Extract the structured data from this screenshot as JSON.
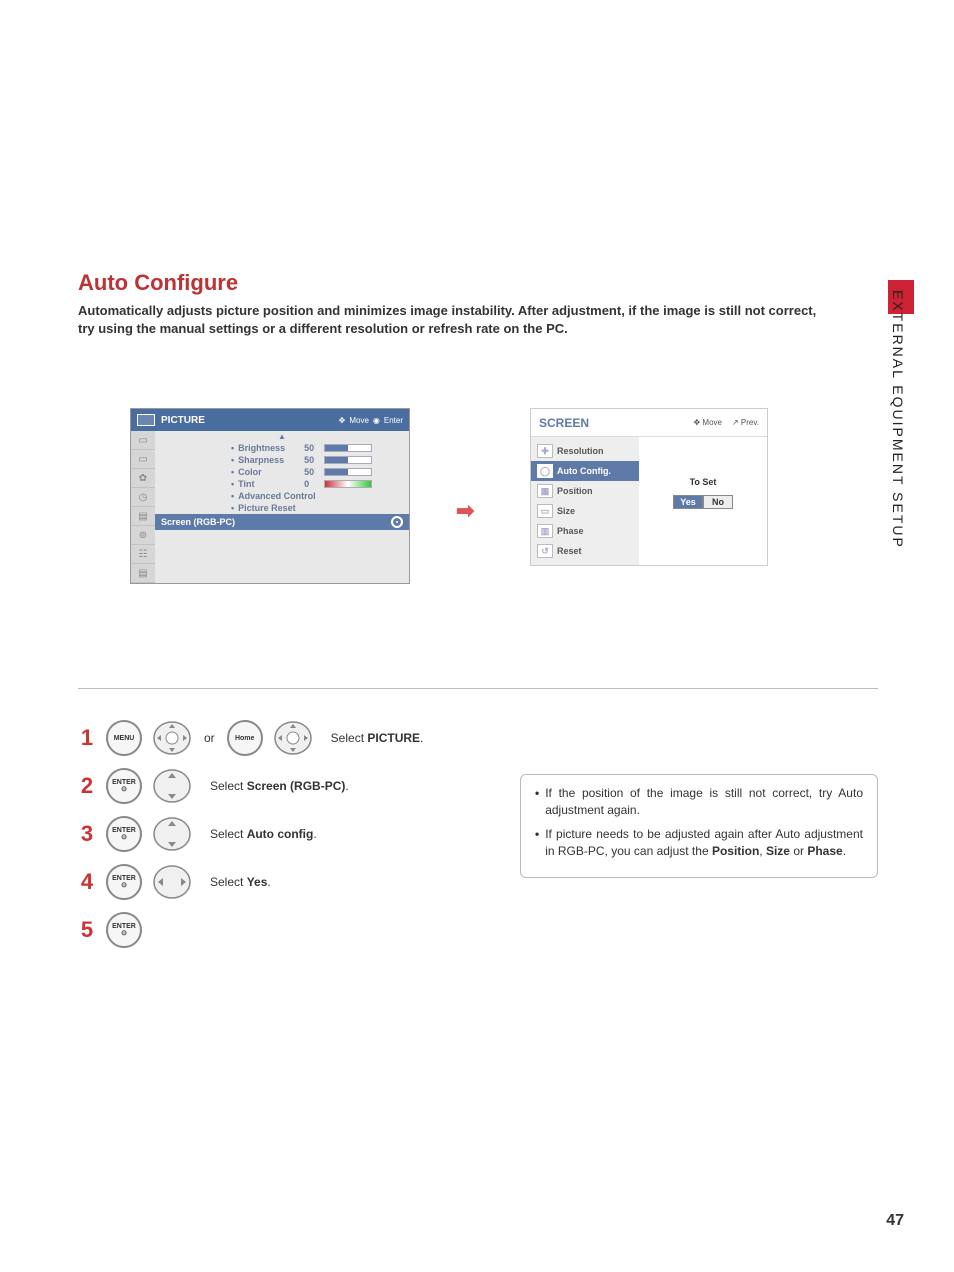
{
  "page": {
    "title": "Auto Configure",
    "description": "Automatically adjusts picture position and minimizes image instability. After adjustment, if the image is still not correct, try using the manual settings or a different resolution or refresh rate on the PC.",
    "side_label": "EXTERNAL EQUIPMENT SETUP",
    "number": "47"
  },
  "picture_menu": {
    "title": "PICTURE",
    "hint_move": "Move",
    "hint_enter": "Enter",
    "items": [
      {
        "label": "Brightness",
        "value": "50",
        "bar_pct": 50
      },
      {
        "label": "Sharpness",
        "value": "50",
        "bar_pct": 50
      },
      {
        "label": "Color",
        "value": "50",
        "bar_pct": 50
      },
      {
        "label": "Tint",
        "value": "0",
        "tint": true
      },
      {
        "label": "Advanced Control"
      },
      {
        "label": "Picture Reset"
      }
    ],
    "highlight": "Screen (RGB-PC)"
  },
  "screen_menu": {
    "title": "SCREEN",
    "hint_move": "Move",
    "hint_prev": "Prev.",
    "items": [
      "Resolution",
      "Auto Config.",
      "Position",
      "Size",
      "Phase",
      "Reset"
    ],
    "selected_index": 1,
    "to_set": "To Set",
    "yes": "Yes",
    "no": "No"
  },
  "steps": {
    "or": "or",
    "btn_menu": "MENU",
    "btn_home": "Home",
    "btn_enter": "ENTER",
    "s1_prefix": "Select ",
    "s1_target": "PICTURE",
    "s2_prefix": "Select ",
    "s2_target": "Screen (RGB-PC)",
    "s3_prefix": "Select ",
    "s3_target": "Auto config",
    "s4_prefix": "Select ",
    "s4_target": "Yes",
    "n1": "1",
    "n2": "2",
    "n3": "3",
    "n4": "4",
    "n5": "5"
  },
  "notes": {
    "n1": "If the position of the image is still not correct, try Auto adjustment again.",
    "n2_a": "If picture needs to be adjusted again after Auto adjustment in RGB-PC, you can adjust the ",
    "n2_b": "Position",
    "n2_c": ", ",
    "n2_d": "Size",
    "n2_e": " or ",
    "n2_f": "Phase",
    "n2_g": "."
  }
}
